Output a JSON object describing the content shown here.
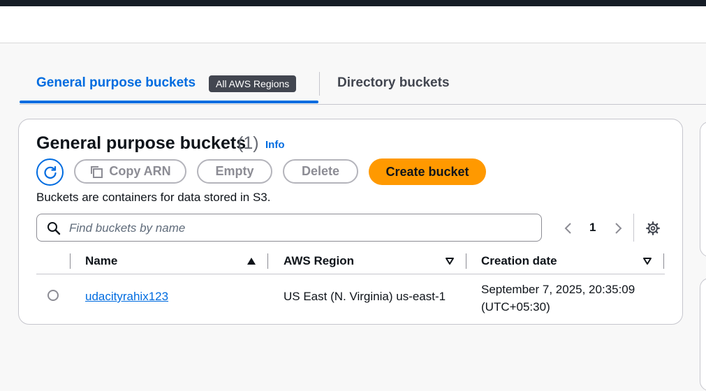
{
  "tabs": {
    "general_label": "General purpose buckets",
    "general_badge": "All AWS Regions",
    "directory_label": "Directory buckets"
  },
  "panel": {
    "title": "General purpose buckets",
    "count": "(1)",
    "info_label": "Info",
    "description": "Buckets are containers for data stored in S3."
  },
  "actions": {
    "copy_arn_label": "Copy ARN",
    "empty_label": "Empty",
    "delete_label": "Delete",
    "create_label": "Create bucket"
  },
  "search": {
    "placeholder": "Find buckets by name"
  },
  "pagination": {
    "current_page": "1"
  },
  "table": {
    "columns": [
      "Name",
      "AWS Region",
      "Creation date"
    ],
    "rows": [
      {
        "name": "udacityrahix123",
        "region": "US East (N. Virginia) us-east-1",
        "creation_date_line1": "September 7, 2025, 20:35:09",
        "creation_date_line2": "(UTC+05:30)"
      }
    ]
  },
  "colors": {
    "accent": "#006ce0",
    "primary_button": "#ff9900",
    "badge_bg": "#424650"
  },
  "icons": [
    "refresh-icon",
    "copy-icon",
    "search-icon",
    "chevron-left-icon",
    "chevron-right-icon",
    "settings-icon",
    "sort-ascending-icon",
    "sort-descending-icon"
  ]
}
